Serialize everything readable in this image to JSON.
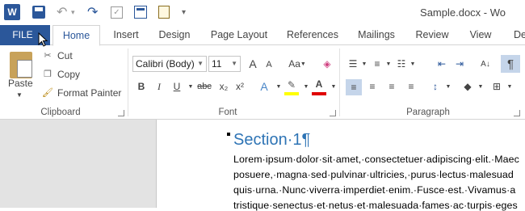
{
  "titlebar": {
    "app_icon_letter": "W",
    "document_title": "Sample.docx - Wo"
  },
  "tabs": [
    "FILE",
    "Home",
    "Insert",
    "Design",
    "Page Layout",
    "References",
    "Mailings",
    "Review",
    "View",
    "De"
  ],
  "clipboard": {
    "paste_label": "Paste",
    "cut_label": "Cut",
    "copy_label": "Copy",
    "format_painter_label": "Format Painter",
    "group_label": "Clipboard"
  },
  "font": {
    "font_name": "Calibri (Body)",
    "font_size": "11",
    "group_label": "Font",
    "bold": "B",
    "italic": "I",
    "underline": "U",
    "strike": "abc",
    "subscript": "x₂",
    "superscript": "x²",
    "grow": "A",
    "shrink": "A",
    "change_case": "Aa",
    "text_effects": "A",
    "highlight_color": "#ffff00",
    "font_color": "#e00000"
  },
  "paragraph": {
    "group_label": "Paragraph",
    "show_marks": "¶"
  },
  "document": {
    "heading": "Section·1¶",
    "lines": [
      "Lorem·ipsum·dolor·sit·amet,·consectetuer·adipiscing·elit.·Maec",
      "posuere,·magna·sed·pulvinar·ultricies,·purus·lectus·malesuad",
      "quis·urna.·Nunc·viverra·imperdiet·enim.·Fusce·est.·Vivamus·a",
      "tristique·senectus·et·netus·et·malesuada·fames·ac·turpis·eges"
    ]
  }
}
